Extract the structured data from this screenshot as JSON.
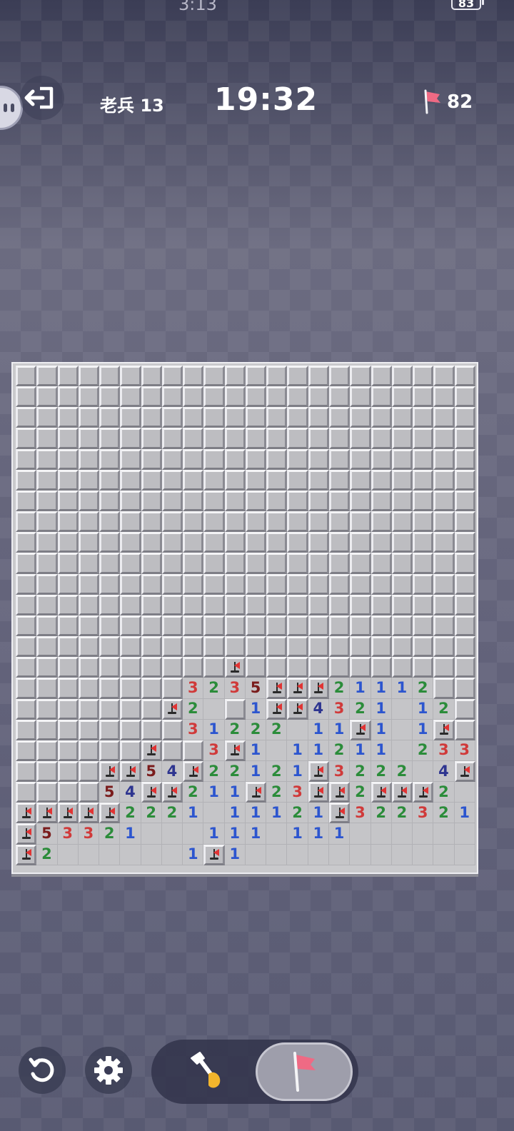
{
  "status_bar": {
    "time": "3:13",
    "battery": "83"
  },
  "header": {
    "level_label": "老兵 13",
    "timer": "19:32",
    "flags_remaining": "82"
  },
  "board": {
    "columns": 22,
    "rows": 24,
    "legend": "C = covered tile, 0 = empty revealed, F = flag, 1-8 = adjacent mine count",
    "grid": [
      "CCCCCCCCCCCCCCCCCCCCCC",
      "CCCCCCCCCCCCCCCCCCCCCC",
      "CCCCCCCCCCCCCCCCCCCCCC",
      "CCCCCCCCCCCCCCCCCCCCCC",
      "CCCCCCCCCCCCCCCCCCCCCC",
      "CCCCCCCCCCCCCCCCCCCCCC",
      "CCCCCCCCCCCCCCCCCCCCCC",
      "CCCCCCCCCCCCCCCCCCCCCC",
      "CCCCCCCCCCCCCCCCCCCCCC",
      "CCCCCCCCCCCCCCCCCCCCCC",
      "CCCCCCCCCCCCCCCCCCCCCC",
      "CCCCCCCCCCCCCCCCCCCCCC",
      "CCCCCCCCCCCCCCCCCCCCCC",
      "CCCCCCCCCCCCCCCCCCCCCC",
      "CCCCCCCCCCFCCCCCCCCCCC",
      "CCCCCCCC3235FFF21112CC",
      "CCCCCCCF20C1FF4321012CC",
      "CCCCCCCC31222 11F101FCC",
      "CCCCCCFCC3F10112110233 1",
      "CCCCFF54F22121F3222 4F2 0",
      "CCCC54FF211F23FF2FFF20",
      "FFFFF2221011121F3223210",
      "F53321000111011100000 0",
      "F20000001F10000000000000"
    ]
  },
  "controls": {
    "restart_icon": "restart-icon",
    "settings_icon": "gear-icon",
    "dig_icon": "shovel-icon",
    "flag_icon": "flag-icon",
    "active_mode": "flag"
  },
  "colors": {
    "number_1": "#2c55cf",
    "number_2": "#2b8c3a",
    "number_3": "#d03a3a",
    "number_4": "#2e3590",
    "number_5": "#7a1c1c",
    "flag": "#e03434"
  }
}
